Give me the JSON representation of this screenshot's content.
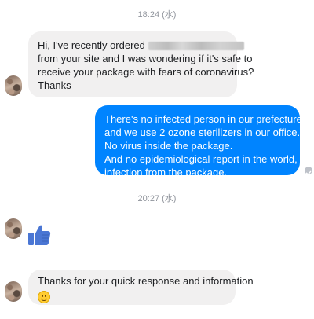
{
  "conversation": {
    "timestamp_1": "18:24 (水)",
    "message_1": {
      "line1_prefix": "Hi, I've recently ordered",
      "line2": "from your site and I was wondering if it's safe to",
      "line3": "receive your package with fears of coronavirus?",
      "line4": "Thanks"
    },
    "reply_1": {
      "line1": "There's no infected person in our prefecture,",
      "line2": "and we use 2 ozone sterilizers in our office.",
      "line3": "No virus inside the package.",
      "line4": "And no epidemiological report in the world,",
      "line5": "infection from the package."
    },
    "timestamp_2": "20:27 (水)",
    "like_icon": "thumbs-up-icon",
    "message_2": {
      "line1": "Thanks for your quick response and information",
      "emoji": "smile-emoji-icon"
    }
  },
  "colors": {
    "outgoing_bubble": "#0084ff",
    "incoming_bubble": "#f1f0f0",
    "like_blue": "#4a76d4"
  }
}
